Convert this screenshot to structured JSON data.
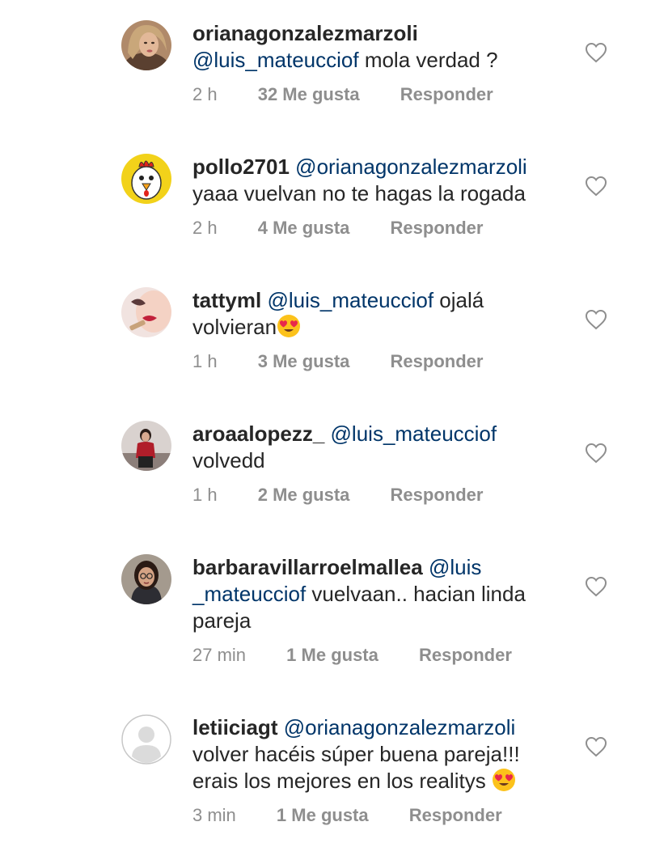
{
  "comments": [
    {
      "username": "orianagonzalezmarzoli",
      "mention": "@luis_mateucciof",
      "text": " mola verdad ?",
      "time": "2 h",
      "likes": "32 Me gusta",
      "reply": "Responder",
      "avatar": "woman-avatar"
    },
    {
      "username": "pollo2701",
      "mention": "@orianagonzalezmarzoli",
      "text": "yaaa vuelvan no te hagas la rogada",
      "time": "2 h",
      "likes": "4 Me gusta",
      "reply": "Responder",
      "avatar": "chicken-avatar"
    },
    {
      "username": "tattyml",
      "mention": "@luis_mateucciof",
      "text": " ojalá volvieran",
      "time": "1 h",
      "likes": "3 Me gusta",
      "reply": "Responder",
      "avatar": "lips-avatar"
    },
    {
      "username": "aroaalopezz_",
      "mention": "@luis_mateucciof",
      "text": "volvedd",
      "time": "1 h",
      "likes": "2 Me gusta",
      "reply": "Responder",
      "avatar": "person-standing-avatar"
    },
    {
      "username": "barbaravillarroelmallea",
      "mention": "@luis _mateucciof",
      "text": " vuelvaan.. hacian linda pareja",
      "time": "27 min",
      "likes": "1 Me gusta",
      "reply": "Responder",
      "avatar": "woman-glasses-avatar"
    },
    {
      "username": "letiiciagt",
      "mention": "@orianagonzalezmarzoli",
      "text": "volver hacéis súper buena pareja!!! erais los mejores en los realitys",
      "time": "3 min",
      "likes": "1 Me gusta",
      "reply": "Responder",
      "avatar": "default-avatar"
    }
  ],
  "colors": {
    "text": "#262626",
    "mention": "#003569",
    "meta": "#8e8e8e",
    "heart_outline": "#8e8e8e"
  }
}
